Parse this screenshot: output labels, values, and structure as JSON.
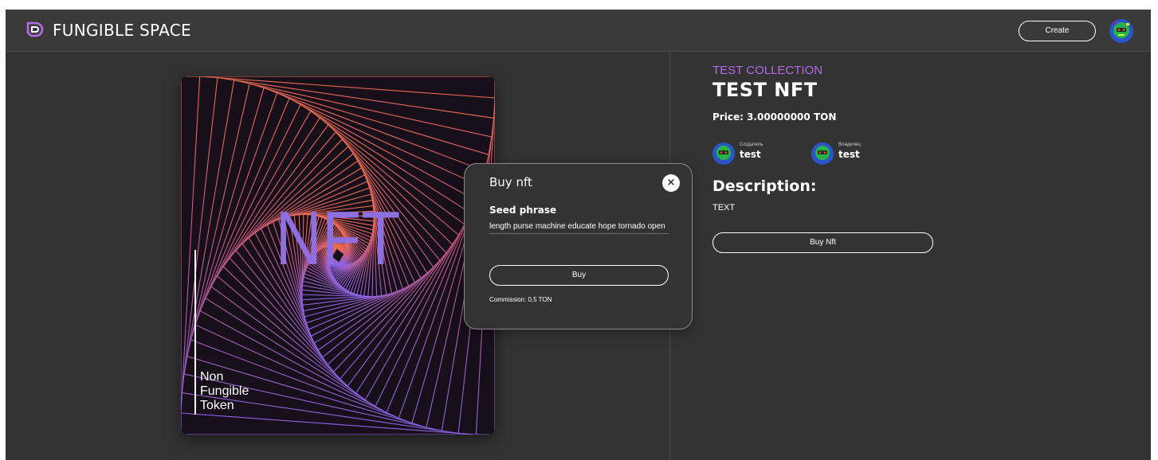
{
  "header": {
    "brand": "FUNGIBLE SPACE",
    "create_label": "Create",
    "avatar_icon": "robot-avatar-icon"
  },
  "nft": {
    "image_big_text": "NFT",
    "image_side_text_1": "Non",
    "image_side_text_2": "Fungible",
    "image_side_text_3": "Token",
    "collection": "TEST COLLECTION",
    "title": "TEST NFT",
    "price": "Price: 3.00000000 TON",
    "creator_role": "Создатель",
    "creator_name": "test",
    "owner_role": "Владелец",
    "owner_name": "test",
    "description_title": "Description:",
    "description_text": "TEXT",
    "buy_label": "Buy Nft"
  },
  "modal": {
    "title": "Buy nft",
    "seed_label": "Seed phrase",
    "seed_value": "length purse machine educate hope tornado open",
    "buy_label": "Buy",
    "commission": "Commission: 0,5 TON"
  },
  "colors": {
    "background": "#333333",
    "accent": "#b56be8",
    "nft_text": "#8e6fe0"
  }
}
